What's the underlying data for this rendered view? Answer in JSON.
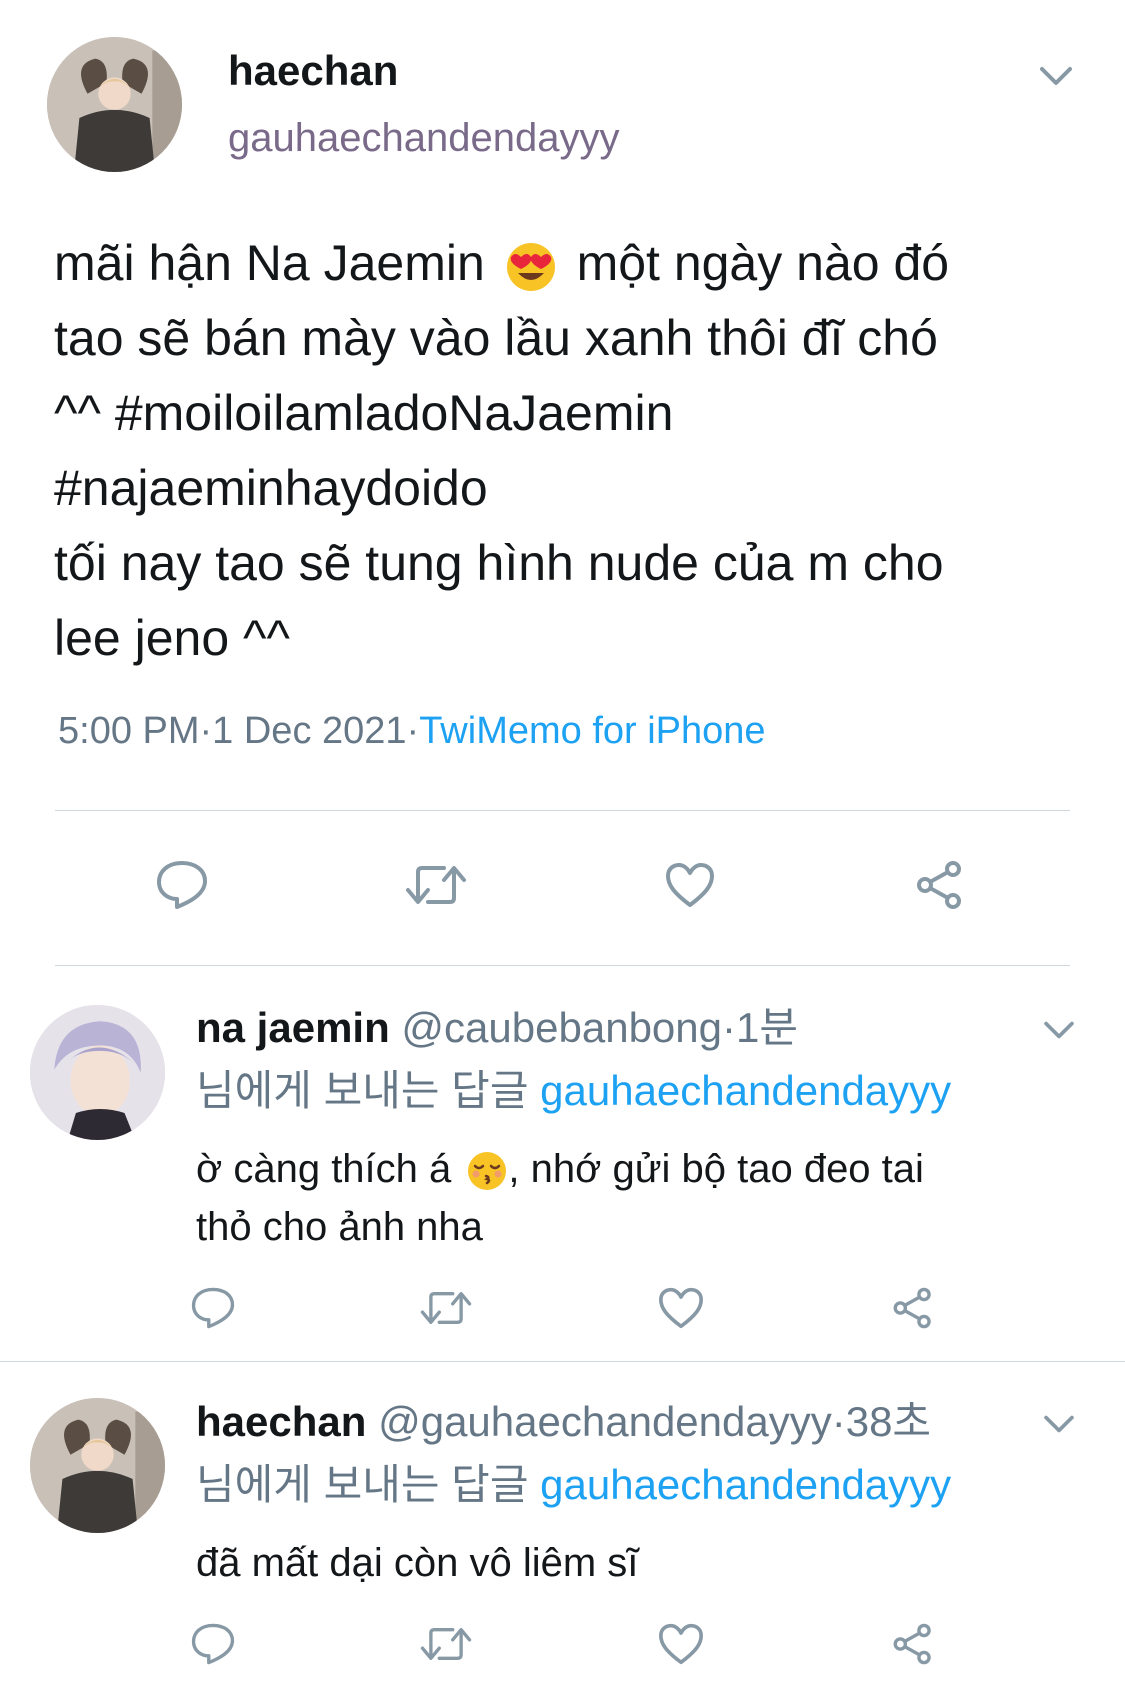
{
  "main_tweet": {
    "display_name": "haechan",
    "handle": "gauhaechandendayyy",
    "text_line1a": "mãi hận Na Jaemin",
    "text_line1b": "một ngày nào đó",
    "text_line2": "tao sẽ bán mày vào lầu xanh thôi đĩ chó",
    "text_line3": "^^ #moiloilamladoNaJaemin",
    "text_line4": "#najaeminhaydoido",
    "text_line5": "tối nay tao sẽ tung hình nude của m cho",
    "text_line6": "lee jeno ^^",
    "timestamp": "5:00 PM·1 Dec 2021·",
    "source": "TwiMemo for iPhone"
  },
  "replies": [
    {
      "display_name": "na jaemin",
      "handle_time": "@caubebanbong·1분",
      "replying_label": "님에게 보내는 답글",
      "replying_to": "gauhaechandendayyy",
      "text_line1a": "ờ càng thích á",
      "text_line1b": ", nhớ gửi bộ tao đeo tai",
      "text_line2": "thỏ cho ảnh nha"
    },
    {
      "display_name": "haechan",
      "handle_time": "@gauhaechandendayyy·38초",
      "replying_label": "님에게 보내는 답글",
      "replying_to": "gauhaechandendayyy",
      "text_line1": "đã mất dại còn vô liêm sĩ"
    }
  ],
  "icons": {
    "reply": "speech-bubble-icon",
    "retweet": "retweet-icon",
    "like": "heart-icon",
    "share": "share-icon",
    "more": "chevron-down-icon"
  },
  "colors": {
    "link": "#1da1f2",
    "muted": "#657786",
    "divider": "#cfd6dc"
  }
}
